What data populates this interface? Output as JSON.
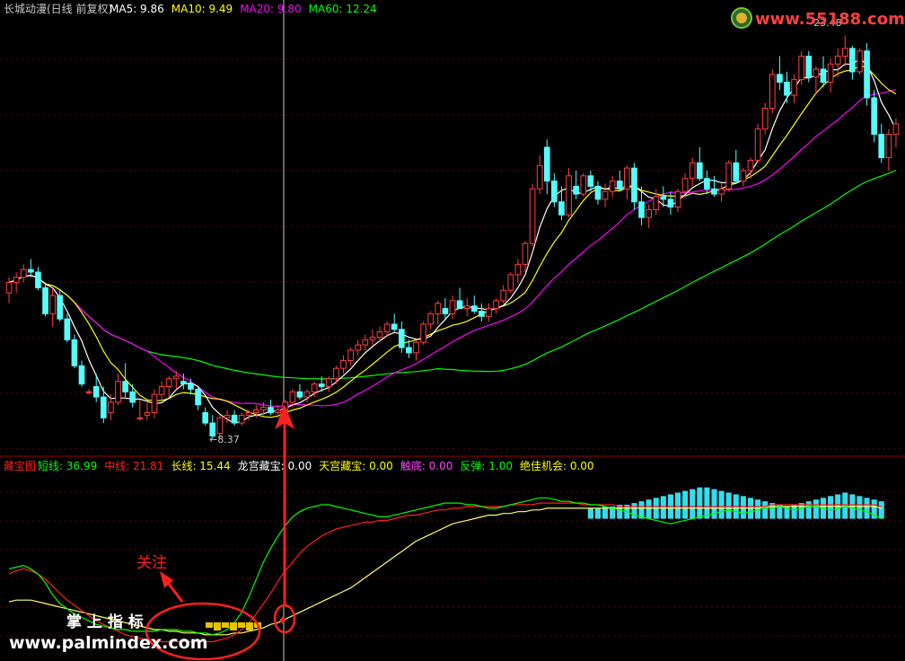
{
  "header": {
    "stock_title": "长城动漫(日线 前复权)",
    "ma": [
      {
        "label": "MA5: ",
        "value": "9.86",
        "color": "#ffffff"
      },
      {
        "label": "MA10: ",
        "value": "9.49",
        "color": "#ffff00"
      },
      {
        "label": "MA20: ",
        "value": "9.80",
        "color": "#ff00ff"
      },
      {
        "label": "MA60: ",
        "value": "12.24",
        "color": "#00ff00"
      }
    ]
  },
  "watermark_top": "www.55188.com",
  "watermark_bottom": {
    "line1": "掌 上 指 标",
    "line2": "www.palmindex.com"
  },
  "colors": {
    "background": "#000000",
    "grid": "#800000",
    "up": "#ff4040",
    "down": "#54ffff",
    "ma5": "#ffffff",
    "ma10": "#ffff00",
    "ma20": "#ff00ff",
    "ma60": "#00ff00",
    "short": "#00ff00",
    "mid": "#ff2020",
    "long": "#ffff66",
    "annotation": "#ff2020"
  },
  "annotation": {
    "label": "关注"
  },
  "indicator_header": {
    "name": "藏宝图",
    "items": [
      {
        "label": "短线: ",
        "value": "36.99",
        "color": "#00ff00"
      },
      {
        "label": "中线: ",
        "value": "21.81",
        "color": "#ff2020"
      },
      {
        "label": "长线: ",
        "value": "15.44",
        "color": "#ffff00"
      },
      {
        "label": "龙宫藏宝: ",
        "value": "0.00",
        "color": "#ffffff"
      },
      {
        "label": "天宫藏宝: ",
        "value": "0.00",
        "color": "#ffff00"
      },
      {
        "label": "触底: ",
        "value": "0.00",
        "color": "#ff40ff"
      },
      {
        "label": "反弹: ",
        "value": "1.00",
        "color": "#00ff00"
      },
      {
        "label": "绝佳机会: ",
        "value": "0.00",
        "color": "#ffff00"
      }
    ]
  },
  "chart_data": [
    {
      "type": "candlestick",
      "price_range": [
        8.0,
        24.5
      ],
      "grid": true,
      "annotations": [
        {
          "label": "←8.37",
          "bar": 29,
          "value": 8.37
        },
        {
          "label": "23.48",
          "bar": 114,
          "value": 23.48
        }
      ],
      "candles_ohlc": [
        [
          14.0,
          14.6,
          13.6,
          14.4
        ],
        [
          14.4,
          14.8,
          14.0,
          14.6
        ],
        [
          14.6,
          15.1,
          14.4,
          14.9
        ],
        [
          14.9,
          15.3,
          14.6,
          14.8
        ],
        [
          14.8,
          15.0,
          14.1,
          14.2
        ],
        [
          14.2,
          14.4,
          13.1,
          13.2
        ],
        [
          13.2,
          14.2,
          12.7,
          13.9
        ],
        [
          13.9,
          14.1,
          12.9,
          13.0
        ],
        [
          13.0,
          13.2,
          12.1,
          12.2
        ],
        [
          12.2,
          12.4,
          11.1,
          11.2
        ],
        [
          11.2,
          11.4,
          10.4,
          10.5
        ],
        [
          10.2,
          10.3,
          10.1,
          10.2
        ],
        [
          10.4,
          10.9,
          9.8,
          10.0
        ],
        [
          10.0,
          10.4,
          9.0,
          9.2
        ],
        [
          9.4,
          10.1,
          9.1,
          9.8
        ],
        [
          9.8,
          10.9,
          9.7,
          10.6
        ],
        [
          10.6,
          11.3,
          10.0,
          10.2
        ],
        [
          10.2,
          10.5,
          9.6,
          9.8
        ],
        [
          9.2,
          9.9,
          9.1,
          9.2
        ],
        [
          9.3,
          9.8,
          9.1,
          9.4
        ],
        [
          9.4,
          10.3,
          9.2,
          10.1
        ],
        [
          10.1,
          10.6,
          9.9,
          10.4
        ],
        [
          10.4,
          10.8,
          10.0,
          10.7
        ],
        [
          10.7,
          11.0,
          10.3,
          10.8
        ],
        [
          10.6,
          10.9,
          10.3,
          10.5
        ],
        [
          10.5,
          10.7,
          10.1,
          10.3
        ],
        [
          10.3,
          10.4,
          9.5,
          9.7
        ],
        [
          9.4,
          9.6,
          8.9,
          9.0
        ],
        [
          9.0,
          9.3,
          8.4,
          8.5
        ],
        [
          8.6,
          9.3,
          8.4,
          9.2
        ],
        [
          9.2,
          9.5,
          9.0,
          9.3
        ],
        [
          9.3,
          9.5,
          8.9,
          9.0
        ],
        [
          9.0,
          9.4,
          8.9,
          9.3
        ],
        [
          9.3,
          9.5,
          9.1,
          9.4
        ],
        [
          9.4,
          9.7,
          9.2,
          9.5
        ],
        [
          9.5,
          9.8,
          9.3,
          9.6
        ],
        [
          9.6,
          9.9,
          9.3,
          9.4
        ],
        [
          9.4,
          9.7,
          9.2,
          9.5
        ],
        [
          9.5,
          9.9,
          9.3,
          9.8
        ],
        [
          9.8,
          10.3,
          9.6,
          10.2
        ],
        [
          10.2,
          10.5,
          9.9,
          10.0
        ],
        [
          10.0,
          10.3,
          9.8,
          10.2
        ],
        [
          10.2,
          10.6,
          10.0,
          10.5
        ],
        [
          10.5,
          10.8,
          10.2,
          10.4
        ],
        [
          10.4,
          10.8,
          10.2,
          10.7
        ],
        [
          10.7,
          11.2,
          10.5,
          11.1
        ],
        [
          11.1,
          11.6,
          10.9,
          11.4
        ],
        [
          11.4,
          11.9,
          11.2,
          11.8
        ],
        [
          11.8,
          12.2,
          11.6,
          12.0
        ],
        [
          12.0,
          12.4,
          11.8,
          12.2
        ],
        [
          12.2,
          12.6,
          12.0,
          12.3
        ],
        [
          12.3,
          12.7,
          12.1,
          12.5
        ],
        [
          12.5,
          12.9,
          12.3,
          12.8
        ],
        [
          12.8,
          13.2,
          12.5,
          12.6
        ],
        [
          12.6,
          12.9,
          11.7,
          11.9
        ],
        [
          11.9,
          12.2,
          11.5,
          11.7
        ],
        [
          11.7,
          12.2,
          11.4,
          12.1
        ],
        [
          12.1,
          12.9,
          12.0,
          12.8
        ],
        [
          12.8,
          13.3,
          12.6,
          13.2
        ],
        [
          13.2,
          13.7,
          12.8,
          13.6
        ],
        [
          13.4,
          13.8,
          13.0,
          13.2
        ],
        [
          13.2,
          13.9,
          13.0,
          13.7
        ],
        [
          13.7,
          14.2,
          13.4,
          13.4
        ],
        [
          13.4,
          13.8,
          13.1,
          13.5
        ],
        [
          13.5,
          13.9,
          13.2,
          13.3
        ],
        [
          13.3,
          13.6,
          12.9,
          13.1
        ],
        [
          13.1,
          13.6,
          12.9,
          13.4
        ],
        [
          13.4,
          13.8,
          13.2,
          13.7
        ],
        [
          13.7,
          14.3,
          13.6,
          14.1
        ],
        [
          14.1,
          14.8,
          14.0,
          14.7
        ],
        [
          14.7,
          15.3,
          14.4,
          15.1
        ],
        [
          15.1,
          16.0,
          14.8,
          15.9
        ],
        [
          15.9,
          18.2,
          15.8,
          18.0
        ],
        [
          18.0,
          19.3,
          17.8,
          18.9
        ],
        [
          19.6,
          19.9,
          17.8,
          18.3
        ],
        [
          18.3,
          18.6,
          17.3,
          17.5
        ],
        [
          17.5,
          18.1,
          16.8,
          17.0
        ],
        [
          17.0,
          18.8,
          16.9,
          18.5
        ],
        [
          18.1,
          18.7,
          17.6,
          17.8
        ],
        [
          17.8,
          18.6,
          17.7,
          18.5
        ],
        [
          18.5,
          18.7,
          17.9,
          18.1
        ],
        [
          18.1,
          18.3,
          17.4,
          17.6
        ],
        [
          17.6,
          18.2,
          17.3,
          17.9
        ],
        [
          17.9,
          18.5,
          17.7,
          18.3
        ],
        [
          18.3,
          18.7,
          17.9,
          18.0
        ],
        [
          18.0,
          18.9,
          17.6,
          18.8
        ],
        [
          18.8,
          19.0,
          17.2,
          17.5
        ],
        [
          17.5,
          18.1,
          16.6,
          16.9
        ],
        [
          16.9,
          17.4,
          16.5,
          17.2
        ],
        [
          17.2,
          18.0,
          17.0,
          17.7
        ],
        [
          17.7,
          18.1,
          17.3,
          17.6
        ],
        [
          17.6,
          17.9,
          17.0,
          17.3
        ],
        [
          17.3,
          18.0,
          17.1,
          17.9
        ],
        [
          17.9,
          18.6,
          17.8,
          18.4
        ],
        [
          18.4,
          19.2,
          18.1,
          19.0
        ],
        [
          19.0,
          19.6,
          18.3,
          18.4
        ],
        [
          18.4,
          18.7,
          17.8,
          18.0
        ],
        [
          18.0,
          18.5,
          17.7,
          17.8
        ],
        [
          17.8,
          18.2,
          17.5,
          18.0
        ],
        [
          18.0,
          19.1,
          17.9,
          19.0
        ],
        [
          19.0,
          19.5,
          18.2,
          18.3
        ],
        [
          18.3,
          18.8,
          18.1,
          18.7
        ],
        [
          18.7,
          19.2,
          18.4,
          19.1
        ],
        [
          19.1,
          20.5,
          19.0,
          20.3
        ],
        [
          20.3,
          21.3,
          20.1,
          21.1
        ],
        [
          21.1,
          22.6,
          20.9,
          22.4
        ],
        [
          22.4,
          23.1,
          21.8,
          22.1
        ],
        [
          22.1,
          22.5,
          21.3,
          21.6
        ],
        [
          21.6,
          22.4,
          21.3,
          22.2
        ],
        [
          22.2,
          23.3,
          22.0,
          23.1
        ],
        [
          23.1,
          23.3,
          22.1,
          22.3
        ],
        [
          22.3,
          22.7,
          21.6,
          22.6
        ],
        [
          22.6,
          23.1,
          21.9,
          22.1
        ],
        [
          22.1,
          23.0,
          21.7,
          22.8
        ],
        [
          22.8,
          23.4,
          22.3,
          23.1
        ],
        [
          23.1,
          23.9,
          22.7,
          23.4
        ],
        [
          23.4,
          23.5,
          22.2,
          22.5
        ],
        [
          22.5,
          23.4,
          22.4,
          23.3
        ],
        [
          23.3,
          23.6,
          21.2,
          21.5
        ],
        [
          21.5,
          21.8,
          19.8,
          20.1
        ],
        [
          20.1,
          20.5,
          19.0,
          19.2
        ],
        [
          19.2,
          20.3,
          18.7,
          20.1
        ],
        [
          20.1,
          20.7,
          19.6,
          20.5
        ]
      ]
    },
    {
      "type": "line",
      "name": "藏宝图",
      "value_range": [
        0,
        100
      ],
      "note": "indicator pane: green short-line, red mid-line, yellow long-line, cyan histogram bars",
      "short": [
        49,
        50,
        51,
        49,
        46,
        41,
        34,
        29,
        26,
        23,
        21,
        19,
        17,
        16,
        15,
        14,
        14,
        13,
        13,
        13,
        13,
        14,
        14,
        14,
        13,
        13,
        12,
        12,
        11,
        12,
        14,
        18,
        24,
        33,
        43,
        53,
        61,
        68,
        74,
        79,
        82,
        84,
        85,
        86,
        86,
        85,
        84,
        83,
        82,
        81,
        80,
        79,
        79,
        80,
        81,
        82,
        83,
        84,
        85,
        86,
        87,
        87,
        87,
        86,
        86,
        85,
        84,
        84,
        85,
        86,
        87,
        88,
        89,
        90,
        90,
        89,
        88,
        88,
        87,
        87,
        86,
        86,
        85,
        84,
        83,
        82,
        80,
        79,
        78,
        77,
        76,
        75,
        76,
        77,
        78,
        79,
        80,
        81,
        82,
        83,
        82,
        81,
        82,
        83,
        84,
        84,
        85,
        84,
        83,
        84,
        85,
        85,
        84,
        83,
        84,
        85,
        84,
        83,
        82,
        80,
        78
      ],
      "mid": [
        46,
        48,
        49,
        48,
        46,
        43,
        39,
        35,
        31,
        28,
        25,
        22,
        19,
        17,
        15,
        13,
        11,
        10,
        9,
        8,
        8,
        7,
        7,
        7,
        7,
        7,
        7,
        7,
        7,
        8,
        9,
        11,
        14,
        18,
        23,
        29,
        35,
        42,
        48,
        53,
        58,
        62,
        65,
        68,
        70,
        72,
        73,
        74,
        75,
        76,
        76,
        77,
        77,
        78,
        79,
        80,
        80,
        81,
        82,
        83,
        83,
        84,
        84,
        85,
        85,
        85,
        85,
        85,
        85,
        86,
        86,
        86,
        86,
        87,
        87,
        87,
        87,
        87,
        87,
        86,
        86,
        86,
        86,
        86,
        85,
        85,
        85,
        85,
        85,
        85,
        85,
        85,
        85,
        85,
        85,
        85,
        85,
        85,
        85,
        85,
        85,
        85,
        85,
        85,
        85,
        86,
        86,
        86,
        86,
        86,
        86,
        86,
        86,
        86,
        86,
        86,
        86,
        86,
        86,
        86,
        85
      ],
      "long": [
        30,
        31,
        31,
        31,
        30,
        29,
        28,
        27,
        26,
        25,
        24,
        23,
        22,
        21,
        20,
        19,
        18,
        17,
        16,
        15,
        14,
        14,
        13,
        13,
        12,
        12,
        12,
        11,
        11,
        11,
        11,
        12,
        12,
        13,
        14,
        15,
        17,
        18,
        20,
        22,
        24,
        26,
        28,
        30,
        32,
        34,
        36,
        38,
        41,
        44,
        47,
        50,
        53,
        56,
        59,
        62,
        65,
        67,
        69,
        71,
        73,
        75,
        76,
        77,
        78,
        79,
        80,
        80,
        81,
        81,
        82,
        82,
        83,
        83,
        84,
        84,
        84,
        84,
        84,
        84,
        84,
        84,
        84,
        84,
        84,
        84,
        84,
        84,
        84,
        84,
        84,
        84,
        84,
        84,
        84,
        84,
        84,
        84,
        84,
        84,
        84,
        84,
        84,
        84,
        85,
        85,
        85,
        85,
        85,
        85,
        85,
        85,
        85,
        85,
        85,
        85,
        85,
        85,
        85,
        85,
        84
      ],
      "bars": [
        0,
        0,
        0,
        0,
        0,
        0,
        0,
        0,
        0,
        0,
        0,
        0,
        0,
        0,
        0,
        0,
        0,
        0,
        0,
        0,
        0,
        0,
        0,
        0,
        0,
        0,
        0,
        0,
        0,
        0,
        0,
        0,
        0,
        0,
        0,
        0,
        0,
        0,
        0,
        0,
        0,
        0,
        0,
        0,
        0,
        0,
        0,
        0,
        0,
        0,
        0,
        0,
        0,
        0,
        0,
        0,
        0,
        0,
        0,
        0,
        0,
        0,
        0,
        0,
        0,
        0,
        0,
        0,
        0,
        0,
        0,
        0,
        0,
        0,
        0,
        0,
        0,
        0,
        0,
        0,
        84,
        84,
        85,
        85,
        86,
        86,
        87,
        88,
        89,
        90,
        91,
        92,
        93,
        94,
        95,
        96,
        96,
        95,
        94,
        93,
        92,
        91,
        90,
        89,
        88,
        87,
        86,
        85,
        86,
        87,
        88,
        89,
        90,
        91,
        92,
        93,
        92,
        91,
        90,
        89,
        88
      ]
    }
  ]
}
